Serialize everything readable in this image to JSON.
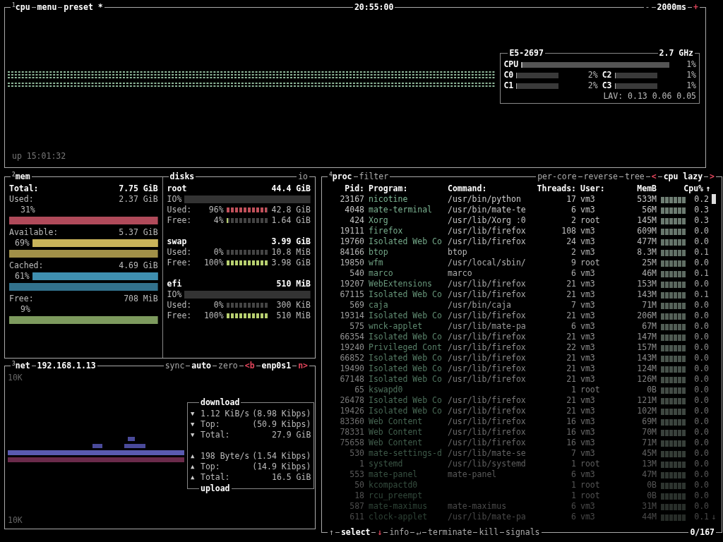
{
  "cpu_box": {
    "header": {
      "left": [
        {
          "text": "$^{1}$cpu",
          "kind": "bold"
        },
        {
          "text": "menu",
          "kind": "bold"
        },
        {
          "text": "preset *",
          "kind": "bold"
        }
      ],
      "center": [
        {
          "text": "20:55:00",
          "kind": "bold"
        }
      ],
      "right": [
        {
          "text": "-",
          "kind": "dim"
        },
        {
          "text": "2000ms",
          "kind": "bold"
        },
        {
          "text": "+",
          "kind": "key"
        }
      ]
    },
    "uptime": "up 15:01:32",
    "info": {
      "model": "E5-2697",
      "freq": "2.7 GHz",
      "total": {
        "label": "CPU",
        "level": 0.01,
        "percent": "1%"
      },
      "cores": [
        {
          "label": "C0",
          "level": 0.02,
          "percent": "2%"
        },
        {
          "label": "C2",
          "level": 0.01,
          "percent": "1%"
        },
        {
          "label": "C1",
          "level": 0.02,
          "percent": "2%"
        },
        {
          "label": "C3",
          "level": 0.01,
          "percent": "1%"
        }
      ],
      "load": "LAV: 0.13 0.06 0.05"
    }
  },
  "mem_box": {
    "header": {
      "left": [
        {
          "text": "$^{2}$mem",
          "kind": "bold"
        }
      ]
    },
    "total": {
      "label": "Total:",
      "value": "7.75 GiB"
    },
    "items": [
      {
        "label": "Used:",
        "value": "2.37 GiB",
        "percent": "31%",
        "kind": "split",
        "color": "#b04a5a"
      },
      {
        "label": "Available:",
        "value": "5.37 GiB",
        "percent": "69%",
        "kind": "inline",
        "color": "#c9b45a"
      },
      {
        "label": "Cached:",
        "value": "4.69 GiB",
        "percent": "61%",
        "kind": "inline",
        "color": "#3f8fb0"
      },
      {
        "label": "Free:",
        "value": "708 MiB",
        "percent": "9%",
        "kind": "split",
        "color": "#7d9a5e"
      }
    ]
  },
  "disks_box": {
    "header": {
      "left": [
        {
          "text": "disks",
          "kind": "bold"
        }
      ],
      "right": [
        {
          "text": "io",
          "kind": "dim"
        }
      ]
    },
    "disks": [
      {
        "name": "root",
        "size": "44.4 GiB",
        "io_label": "IO%",
        "rows": [
          {
            "label": "Used:",
            "percent": "96%",
            "level": 0.96,
            "value": "42.8 GiB",
            "kind": "used"
          },
          {
            "label": "Free:",
            "percent": "4%",
            "level": 0.04,
            "value": "1.64 GiB",
            "kind": "free"
          }
        ]
      },
      {
        "name": "swap",
        "size": "3.99 GiB",
        "rows": [
          {
            "label": "Used:",
            "percent": "0%",
            "level": 0,
            "value": "10.8 MiB",
            "kind": "used"
          },
          {
            "label": "Free:",
            "percent": "100%",
            "level": 1,
            "value": "3.98 GiB",
            "kind": "free"
          }
        ]
      },
      {
        "name": "efi",
        "size": "510 MiB",
        "io_label": "IO%",
        "rows": [
          {
            "label": "Used:",
            "percent": "0%",
            "level": 0,
            "value": "300 KiB",
            "kind": "used"
          },
          {
            "label": "Free:",
            "percent": "100%",
            "level": 1,
            "value": "510 MiB",
            "kind": "free"
          }
        ]
      }
    ]
  },
  "net_box": {
    "header": {
      "left": [
        {
          "text": "$^{3}$net",
          "kind": "bold"
        },
        {
          "text": "192.168.1.13",
          "kind": "bold"
        }
      ],
      "right": [
        {
          "text": "sync",
          "kind": "dim"
        },
        {
          "text": "auto",
          "kind": "bold"
        },
        {
          "text": "zero",
          "kind": "dim"
        },
        {
          "text": "<b",
          "kind": "key"
        },
        {
          "text": "enp0s1",
          "kind": "bold"
        },
        {
          "text": "n>",
          "kind": "key"
        }
      ]
    },
    "scale_top": "10K",
    "scale_bottom": "10K",
    "download_title": "download",
    "upload_title": "upload",
    "stats": [
      {
        "arrow": "▼",
        "label": "1.12 KiB/s",
        "value": "(8.98 Kibps)"
      },
      {
        "arrow": "▼",
        "label": "Top:",
        "value": "(50.9 Kibps)"
      },
      {
        "arrow": "▼",
        "label": "Total:",
        "value": "27.9 GiB"
      },
      {
        "arrow": "▲",
        "label": "198 Byte/s",
        "value": "(1.54 Kibps)"
      },
      {
        "arrow": "▲",
        "label": "Top:",
        "value": "(14.9 Kibps)"
      },
      {
        "arrow": "▲",
        "label": "Total:",
        "value": "16.5 GiB"
      }
    ]
  },
  "proc_box": {
    "header": {
      "left": [
        {
          "text": "$^{4}$proc",
          "kind": "bold"
        },
        {
          "text": "filter",
          "kind": "dim"
        }
      ],
      "right": [
        {
          "text": "per-core",
          "kind": "dim"
        },
        {
          "text": "reverse",
          "kind": "dim"
        },
        {
          "text": "tree",
          "kind": "dim"
        },
        {
          "text": "<",
          "kind": "key"
        },
        {
          "text": "cpu lazy",
          "kind": "bold"
        },
        {
          "text": ">",
          "kind": "key"
        }
      ]
    },
    "columns": [
      "Pid:",
      "Program:",
      "Command:",
      "Threads:",
      "User:",
      "MemB",
      "Cpu%"
    ],
    "sort_arrow": "↑",
    "end_arrow": "↓",
    "rows": [
      {
        "pid": "23167",
        "program": "nicotine",
        "command": "/usr/bin/python",
        "threads": "17",
        "user": "vm3",
        "mem": "533M",
        "cpu": "0.2"
      },
      {
        "pid": "4048",
        "program": "mate-terminal",
        "command": "/usr/bin/mate-te",
        "threads": "6",
        "user": "vm3",
        "mem": "56M",
        "cpu": "0.3"
      },
      {
        "pid": "424",
        "program": "Xorg",
        "command": "/usr/lib/Xorg :0",
        "threads": "2",
        "user": "root",
        "mem": "145M",
        "cpu": "0.3"
      },
      {
        "pid": "19111",
        "program": "firefox",
        "command": "/usr/lib/firefox",
        "threads": "108",
        "user": "vm3",
        "mem": "609M",
        "cpu": "0.0"
      },
      {
        "pid": "19760",
        "program": "Isolated Web Co",
        "command": "/usr/lib/firefox",
        "threads": "24",
        "user": "vm3",
        "mem": "477M",
        "cpu": "0.0"
      },
      {
        "pid": "84166",
        "program": "btop",
        "command": "btop",
        "threads": "2",
        "user": "vm3",
        "mem": "8.3M",
        "cpu": "0.1"
      },
      {
        "pid": "19850",
        "program": "wfm",
        "command": "/usr/local/sbin/",
        "threads": "9",
        "user": "root",
        "mem": "25M",
        "cpu": "0.0"
      },
      {
        "pid": "540",
        "program": "marco",
        "command": "marco",
        "threads": "6",
        "user": "vm3",
        "mem": "46M",
        "cpu": "0.1"
      },
      {
        "pid": "19207",
        "program": "WebExtensions",
        "command": "/usr/lib/firefox",
        "threads": "21",
        "user": "vm3",
        "mem": "153M",
        "cpu": "0.0"
      },
      {
        "pid": "67115",
        "program": "Isolated Web Co",
        "command": "/usr/lib/firefox",
        "threads": "21",
        "user": "vm3",
        "mem": "143M",
        "cpu": "0.1"
      },
      {
        "pid": "569",
        "program": "caja",
        "command": "/usr/bin/caja",
        "threads": "7",
        "user": "vm3",
        "mem": "71M",
        "cpu": "0.0"
      },
      {
        "pid": "19314",
        "program": "Isolated Web Co",
        "command": "/usr/lib/firefox",
        "threads": "21",
        "user": "vm3",
        "mem": "206M",
        "cpu": "0.0"
      },
      {
        "pid": "575",
        "program": "wnck-applet",
        "command": "/usr/lib/mate-pa",
        "threads": "6",
        "user": "vm3",
        "mem": "67M",
        "cpu": "0.0"
      },
      {
        "pid": "66354",
        "program": "Isolated Web Co",
        "command": "/usr/lib/firefox",
        "threads": "21",
        "user": "vm3",
        "mem": "147M",
        "cpu": "0.0"
      },
      {
        "pid": "19240",
        "program": "Privileged Cont",
        "command": "/usr/lib/firefox",
        "threads": "22",
        "user": "vm3",
        "mem": "157M",
        "cpu": "0.0"
      },
      {
        "pid": "66852",
        "program": "Isolated Web Co",
        "command": "/usr/lib/firefox",
        "threads": "21",
        "user": "vm3",
        "mem": "143M",
        "cpu": "0.0"
      },
      {
        "pid": "19490",
        "program": "Isolated Web Co",
        "command": "/usr/lib/firefox",
        "threads": "21",
        "user": "vm3",
        "mem": "124M",
        "cpu": "0.0"
      },
      {
        "pid": "67148",
        "program": "Isolated Web Co",
        "command": "/usr/lib/firefox",
        "threads": "21",
        "user": "vm3",
        "mem": "126M",
        "cpu": "0.0"
      },
      {
        "pid": "65",
        "program": "kswapd0",
        "threads": "1",
        "user": "root",
        "mem": "0B",
        "cpu": "0.0"
      },
      {
        "pid": "26478",
        "program": "Isolated Web Co",
        "command": "/usr/lib/firefox",
        "threads": "21",
        "user": "vm3",
        "mem": "121M",
        "cpu": "0.0"
      },
      {
        "pid": "19426",
        "program": "Isolated Web Co",
        "command": "/usr/lib/firefox",
        "threads": "21",
        "user": "vm3",
        "mem": "102M",
        "cpu": "0.0"
      },
      {
        "pid": "83360",
        "program": "Web Content",
        "command": "/usr/lib/firefox",
        "threads": "16",
        "user": "vm3",
        "mem": "69M",
        "cpu": "0.0"
      },
      {
        "pid": "78331",
        "program": "Web Content",
        "command": "/usr/lib/firefox",
        "threads": "16",
        "user": "vm3",
        "mem": "70M",
        "cpu": "0.0"
      },
      {
        "pid": "75658",
        "program": "Web Content",
        "command": "/usr/lib/firefox",
        "threads": "16",
        "user": "vm3",
        "mem": "71M",
        "cpu": "0.0"
      },
      {
        "pid": "530",
        "program": "mate-settings-d",
        "command": "/usr/lib/mate-se",
        "threads": "7",
        "user": "vm3",
        "mem": "45M",
        "cpu": "0.0"
      },
      {
        "pid": "1",
        "program": "systemd",
        "command": "/usr/lib/systemd",
        "threads": "1",
        "user": "root",
        "mem": "13M",
        "cpu": "0.0"
      },
      {
        "pid": "553",
        "program": "mate-panel",
        "command": "mate-panel",
        "threads": "6",
        "user": "vm3",
        "mem": "47M",
        "cpu": "0.0"
      },
      {
        "pid": "50",
        "program": "kcompactd0",
        "threads": "1",
        "user": "root",
        "mem": "0B",
        "cpu": "0.0"
      },
      {
        "pid": "18",
        "program": "rcu_preempt",
        "threads": "1",
        "user": "root",
        "mem": "0B",
        "cpu": "0.0"
      },
      {
        "pid": "587",
        "program": "mate-maximus",
        "command": "mate-maximus",
        "threads": "6",
        "user": "vm3",
        "mem": "31M",
        "cpu": "0.0"
      },
      {
        "pid": "611",
        "program": "clock-applet",
        "command": "/usr/lib/mate-pa",
        "threads": "6",
        "user": "vm3",
        "mem": "44M",
        "cpu": "0.1"
      }
    ],
    "footer": [
      {
        "text": "↑",
        "kind": "dim"
      },
      {
        "text": "select",
        "kind": "bold"
      },
      {
        "text": "↓",
        "kind": "key"
      },
      {
        "text": "info",
        "kind": "dim"
      },
      {
        "text": "↵",
        "kind": "dim"
      },
      {
        "text": "terminate",
        "kind": "dim"
      },
      {
        "text": "kill",
        "kind": "dim"
      },
      {
        "text": "signals",
        "kind": "dim"
      }
    ],
    "count": "0/167"
  }
}
